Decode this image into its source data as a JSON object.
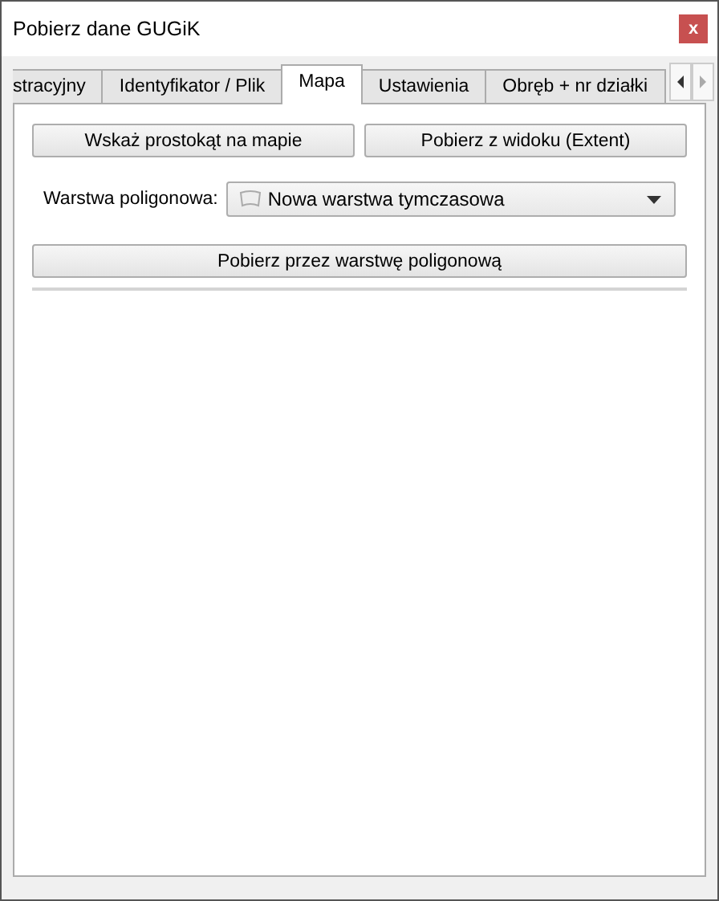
{
  "window": {
    "title": "Pobierz dane GUGiK",
    "close": "x"
  },
  "tabs": [
    {
      "label": "stracyjny",
      "selected": false
    },
    {
      "label": "Identyfikator / Plik",
      "selected": false
    },
    {
      "label": "Mapa",
      "selected": true
    },
    {
      "label": "Ustawienia",
      "selected": false
    },
    {
      "label": "Obręb + nr działki",
      "selected": false
    }
  ],
  "buttons": [
    "Wskaż prostokąt na mapie",
    "Pobierz z widoku (Extent)"
  ],
  "layer": {
    "label": "Warstwa poligonowa:",
    "value": "Nowa warstwa tymczasowa"
  },
  "main_button": "Pobierz przez warstwę poligonową"
}
